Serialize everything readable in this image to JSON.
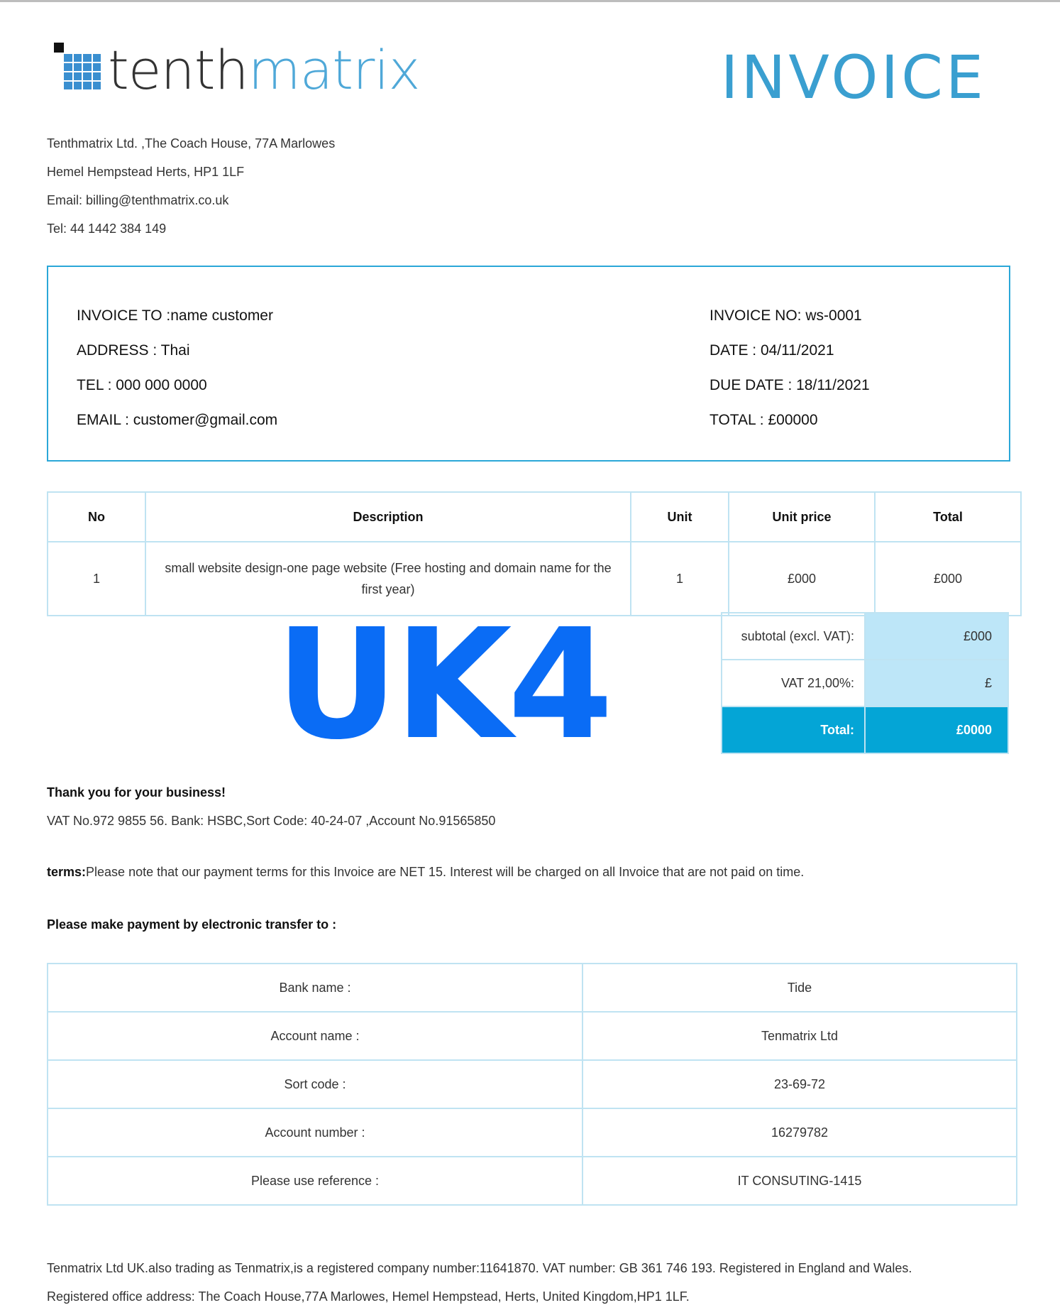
{
  "logo": {
    "text_dark": "tenth",
    "text_light": "matrix"
  },
  "title": "INVOICE",
  "company": {
    "address1": "Tenthmatrix Ltd. ,The Coach House, 77A Marlowes",
    "address2": "Hemel Hempstead Herts, HP1 1LF",
    "email": "Email: billing@tenthmatrix.co.uk",
    "tel": "Tel: 44 1442 384 149"
  },
  "customer": {
    "invoice_to": "INVOICE TO :name customer",
    "address": "ADDRESS : Thai",
    "tel": "TEL : 000 000 0000",
    "email": "EMAIL : customer@gmail.com"
  },
  "invoice_info": {
    "number": "INVOICE NO: ws-0001",
    "date": "DATE : 04/11/2021",
    "due_date": "DUE DATE : 18/11/2021",
    "total": "TOTAL : £00000"
  },
  "items": {
    "headers": [
      "No",
      "Description",
      "Unit",
      "Unit price",
      "Total"
    ],
    "rows": [
      {
        "no": "1",
        "description": "small website design-one page website (Free hosting and domain name for the first year)",
        "unit": "1",
        "unit_price": "£000",
        "total": "£000"
      }
    ]
  },
  "summary": {
    "subtotal_label": "subtotal (excl. VAT):",
    "subtotal_value": "£000",
    "vat_label": "VAT 21,00%:",
    "vat_value": "£",
    "total_label": "Total:",
    "total_value": "£0000"
  },
  "stamp": "UK4",
  "thanks": "Thank you for your business!",
  "vat_line": "VAT No.972 9855 56. Bank: HSBC,Sort Code: 40-24-07 ,Account No.91565850",
  "terms": {
    "label": "terms:",
    "text": "Please note that our payment terms for this Invoice are NET 15. Interest will be charged on all Invoice that are not paid on time."
  },
  "payment_heading": "Please make payment by electronic transfer to :",
  "bank": [
    {
      "label": "Bank name :",
      "value": "Tide"
    },
    {
      "label": "Account name :",
      "value": "Tenmatrix Ltd"
    },
    {
      "label": "Sort code :",
      "value": "23-69-72"
    },
    {
      "label": "Account number :",
      "value": "16279782"
    },
    {
      "label": "Please use reference :",
      "value": "IT CONSUTING-1415"
    }
  ],
  "footer": {
    "line1": "Tenmatrix Ltd UK.also trading as Tenmatrix,is a registered company number:11641870. VAT number: GB 361 746 193. Registered in England and Wales.",
    "line2": "Registered office address: The Coach House,77A Marlowes, Hemel Hempstead, Herts, United Kingdom,HP1 1LF."
  },
  "colors": {
    "accent": "#2aa7d8",
    "total_bg": "#04a5d6",
    "summary_bg": "#bde6f8",
    "stamp": "#0a6cf5"
  }
}
